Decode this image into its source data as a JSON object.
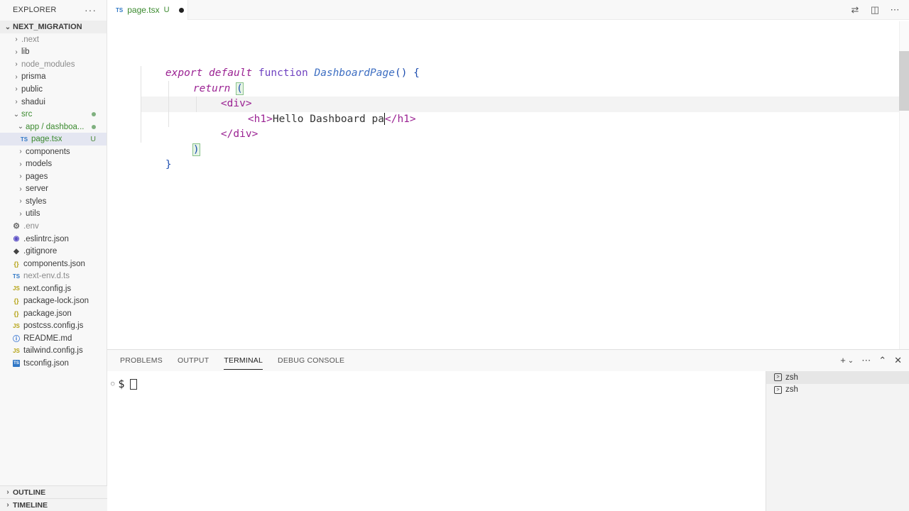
{
  "sidebar": {
    "title": "EXPLORER",
    "more": "···",
    "root": "NEXT_MIGRATION",
    "items": [
      {
        "label": ".next",
        "indent": 1,
        "chev": "›",
        "style": "dim"
      },
      {
        "label": "lib",
        "indent": 1,
        "chev": "›"
      },
      {
        "label": "node_modules",
        "indent": 1,
        "chev": "›",
        "style": "dim"
      },
      {
        "label": "prisma",
        "indent": 1,
        "chev": "›"
      },
      {
        "label": "public",
        "indent": 1,
        "chev": "›"
      },
      {
        "label": "shadui",
        "indent": 1,
        "chev": "›"
      },
      {
        "label": "src",
        "indent": 1,
        "chev": "⌄",
        "style": "green",
        "dot": true
      },
      {
        "label": "app / dashboa...",
        "indent": 2,
        "chev": "⌄",
        "style": "green",
        "dot": true
      },
      {
        "label": "page.tsx",
        "indent": 3,
        "icon": "TS",
        "iconclass": "ts",
        "style": "green",
        "badge": "U",
        "selected": true
      },
      {
        "label": "components",
        "indent": 2,
        "chev": "›"
      },
      {
        "label": "models",
        "indent": 2,
        "chev": "›"
      },
      {
        "label": "pages",
        "indent": 2,
        "chev": "›"
      },
      {
        "label": "server",
        "indent": 2,
        "chev": "›"
      },
      {
        "label": "styles",
        "indent": 2,
        "chev": "›"
      },
      {
        "label": "utils",
        "indent": 2,
        "chev": "›"
      },
      {
        "label": ".env",
        "indent": 1,
        "icon": "⚙",
        "iconclass": "gear",
        "style": "dim"
      },
      {
        "label": ".eslintrc.json",
        "indent": 1,
        "icon": "◉",
        "iconclass": "eslint"
      },
      {
        "label": ".gitignore",
        "indent": 1,
        "icon": "◆",
        "iconclass": "git"
      },
      {
        "label": "components.json",
        "indent": 1,
        "icon": "{}",
        "iconclass": "json"
      },
      {
        "label": "next-env.d.ts",
        "indent": 1,
        "icon": "TS",
        "iconclass": "ts",
        "style": "dim"
      },
      {
        "label": "next.config.js",
        "indent": 1,
        "icon": "JS",
        "iconclass": "js"
      },
      {
        "label": "package-lock.json",
        "indent": 1,
        "icon": "{}",
        "iconclass": "json"
      },
      {
        "label": "package.json",
        "indent": 1,
        "icon": "{}",
        "iconclass": "json"
      },
      {
        "label": "postcss.config.js",
        "indent": 1,
        "icon": "JS",
        "iconclass": "js"
      },
      {
        "label": "README.md",
        "indent": 1,
        "icon": "ⓘ",
        "iconclass": "info"
      },
      {
        "label": "tailwind.config.js",
        "indent": 1,
        "icon": "JS",
        "iconclass": "js"
      },
      {
        "label": "tsconfig.json",
        "indent": 1,
        "icon": "TS",
        "iconclass": "tsbox"
      }
    ],
    "outline": "OUTLINE",
    "timeline": "TIMELINE"
  },
  "tab": {
    "lang": "TS",
    "name": "page.tsx",
    "status": "U"
  },
  "editor": {
    "line1": {
      "kw1": "export",
      "kw2": "default",
      "kw3": "function",
      "fn": "DashboardPage",
      "rest": "() {"
    },
    "line2": {
      "kw": "return",
      "paren": "("
    },
    "line3": {
      "tag": "<div>"
    },
    "line4": {
      "open": "<h1>",
      "text": "Hello Dashboard pa",
      "close": "</h1>"
    },
    "line5": {
      "tag": "</div>"
    },
    "line6": {
      "paren": ")"
    },
    "line7": {
      "brace": "}"
    }
  },
  "panel": {
    "tabs": [
      "PROBLEMS",
      "OUTPUT",
      "TERMINAL",
      "DEBUG CONSOLE"
    ],
    "active_tab": "TERMINAL",
    "prompt_circle": "○",
    "prompt_symbol": "$",
    "terminals": [
      {
        "label": "zsh",
        "active": true
      },
      {
        "label": "zsh",
        "active": false
      }
    ]
  }
}
